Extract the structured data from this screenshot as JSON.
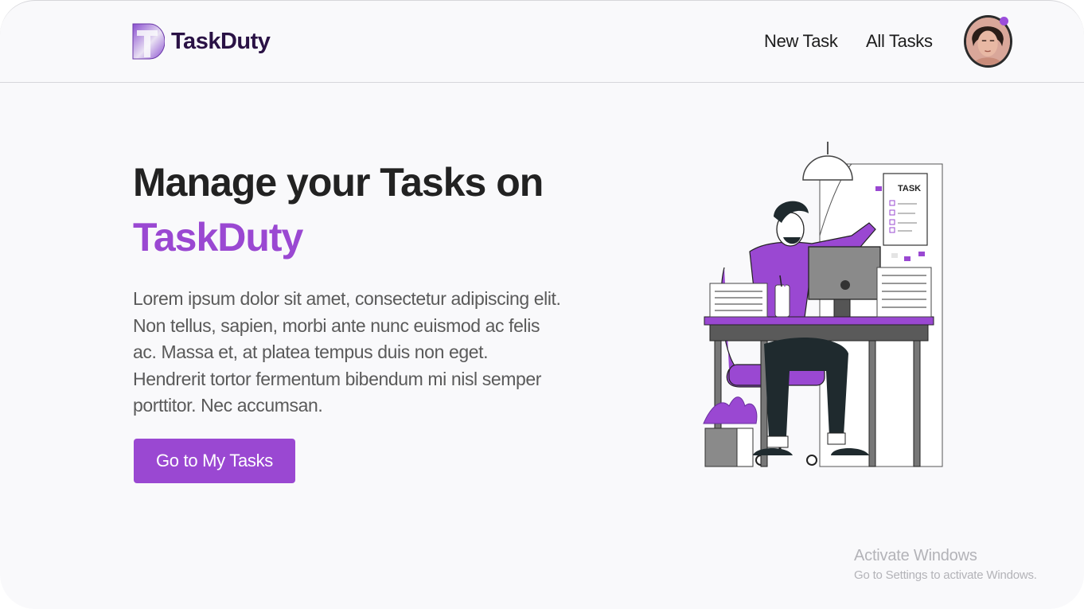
{
  "brand": {
    "name": "TaskDuty",
    "logo_icon": "taskduty-logo-icon"
  },
  "nav": {
    "links": [
      {
        "label": "New Task"
      },
      {
        "label": "All Tasks"
      }
    ],
    "avatar_icon": "user-avatar-icon"
  },
  "hero": {
    "title_line1": "Manage your Tasks on",
    "title_line2": "TaskDuty",
    "description": "Lorem ipsum dolor sit amet, consectetur adipiscing elit. Non tellus, sapien, morbi ante nunc euismod ac felis ac. Massa et, at platea tempus duis non eget. Hendrerit tortor fermentum bibendum mi nisl semper porttitor. Nec accumsan.",
    "cta_label": "Go to My Tasks",
    "illustration": {
      "icon": "person-at-desk-illustration",
      "task_card_title": "TASK"
    }
  },
  "os_watermark": {
    "title": "Activate Windows",
    "subtitle": "Go to Settings to activate Windows."
  },
  "colors": {
    "accent": "#9a48d2",
    "brand_text": "#2a1245",
    "heading": "#222222",
    "body_text": "#5a5a5a",
    "background": "#f9f9fb"
  }
}
